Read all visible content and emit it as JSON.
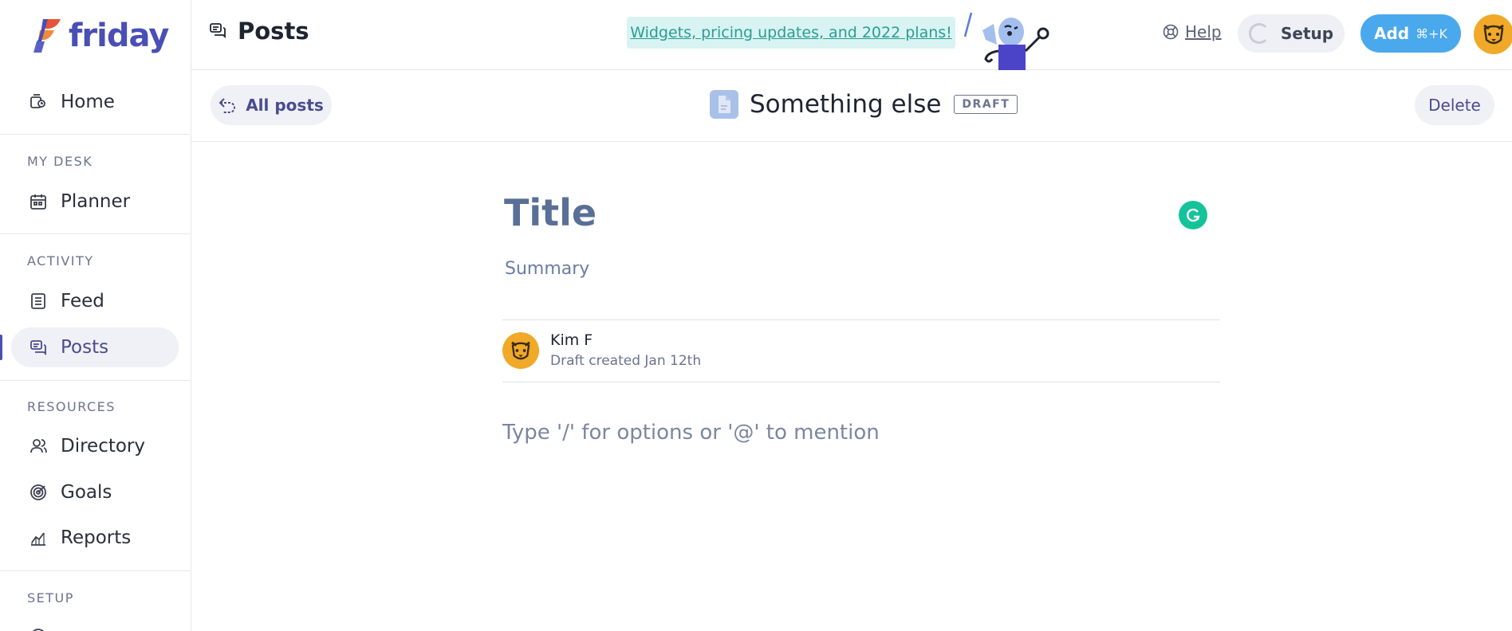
{
  "app": {
    "name": "friday",
    "brand_color": "#4a4fb5"
  },
  "sidebar": {
    "home": "Home",
    "sections": {
      "my_desk": "MY DESK",
      "activity": "ACTIVITY",
      "resources": "RESOURCES",
      "setup": "SETUP"
    },
    "items": {
      "planner": "Planner",
      "feed": "Feed",
      "posts": "Posts",
      "directory": "Directory",
      "goals": "Goals",
      "reports": "Reports"
    },
    "active": "posts"
  },
  "header": {
    "title": "Posts",
    "announcement": "Widgets, pricing updates, and 2022 plans!",
    "help": "Help",
    "setup": "Setup",
    "add": "Add",
    "add_shortcut": "⌘+K"
  },
  "post_toolbar": {
    "back": "All posts",
    "post_name": "Something else",
    "status": "DRAFT",
    "delete": "Delete"
  },
  "editor": {
    "title_placeholder": "Title",
    "summary_placeholder": "Summary",
    "author": "Kim F",
    "author_meta": "Draft created Jan 12th",
    "body_placeholder": "Type '/' for options or '@' to mention"
  },
  "icons": [
    "friday-logo",
    "home-icon",
    "planner-icon",
    "feed-icon",
    "posts-icon",
    "directory-icon",
    "goals-icon",
    "reports-icon",
    "help-icon",
    "setup-spinner",
    "back-arrow-icon",
    "document-icon",
    "grammarly-icon",
    "dog-avatar"
  ]
}
